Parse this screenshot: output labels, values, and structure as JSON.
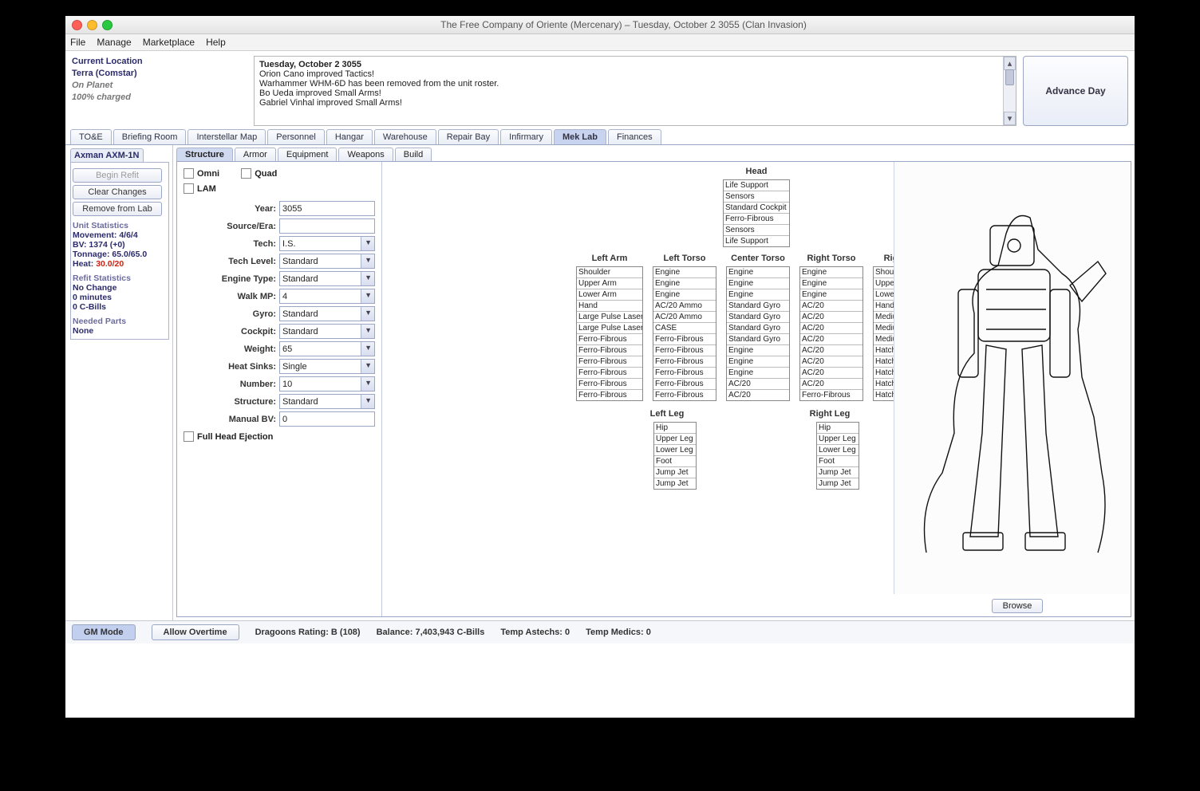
{
  "window": {
    "title": "The Free Company of Oriente (Mercenary) – Tuesday, October 2 3055 (Clan Invasion)"
  },
  "menu": {
    "file": "File",
    "manage": "Manage",
    "marketplace": "Marketplace",
    "help": "Help"
  },
  "location": {
    "label": "Current Location",
    "place": "Terra (Comstar)",
    "status": "On Planet",
    "charge": "100% charged"
  },
  "log": {
    "date": "Tuesday, October 2 3055",
    "lines": [
      "Orion Cano improved Tactics!",
      "Warhammer WHM-6D has been removed from the unit roster.",
      "Bo Ueda improved Small Arms!",
      "Gabriel Vinhal improved Small Arms!"
    ]
  },
  "advance": "Advance Day",
  "mainTabs": [
    "TO&E",
    "Briefing Room",
    "Interstellar Map",
    "Personnel",
    "Hangar",
    "Warehouse",
    "Repair Bay",
    "Infirmary",
    "Mek Lab",
    "Finances"
  ],
  "mainActive": "Mek Lab",
  "sidebar": {
    "unitTab": "Axman AXM-1N",
    "beginRefit": "Begin Refit",
    "clearChanges": "Clear Changes",
    "removeLab": "Remove from Lab",
    "unitStatsLabel": "Unit Statistics",
    "movement": "Movement: 4/6/4",
    "bv": "BV: 1374 (+0)",
    "tonnage": "Tonnage: 65.0/65.0",
    "heatLabel": "Heat:",
    "heatValue": "30.0/20",
    "refitLabel": "Refit Statistics",
    "noChange": "No Change",
    "minutes": "0 minutes",
    "cbills": "0 C-Bills",
    "neededLabel": "Needed Parts",
    "none": "None"
  },
  "subTabs": [
    "Structure",
    "Armor",
    "Equipment",
    "Weapons",
    "Build"
  ],
  "subActive": "Structure",
  "form": {
    "omni": "Omni",
    "quad": "Quad",
    "lam": "LAM",
    "fullHead": "Full Head Ejection",
    "yearL": "Year:",
    "year": "3055",
    "sourceL": "Source/Era:",
    "source": "",
    "techL": "Tech:",
    "tech": "I.S.",
    "techLevelL": "Tech Level:",
    "techLevel": "Standard",
    "engineL": "Engine Type:",
    "engine": "Standard",
    "walkL": "Walk MP:",
    "walk": "4",
    "gyroL": "Gyro:",
    "gyro": "Standard",
    "cockpitL": "Cockpit:",
    "cockpit": "Standard",
    "weightL": "Weight:",
    "weight": "65",
    "hsL": "Heat Sinks:",
    "hs": "Single",
    "numL": "Number:",
    "num": "10",
    "structL": "Structure:",
    "struct": "Standard",
    "mbvL": "Manual BV:",
    "mbv": "0"
  },
  "crits": {
    "head": {
      "title": "Head",
      "slots": [
        "Life Support",
        "Sensors",
        "Standard Cockpit",
        "Ferro-Fibrous",
        "Sensors",
        "Life Support"
      ]
    },
    "la": {
      "title": "Left Arm",
      "slots": [
        "Shoulder",
        "Upper Arm",
        "Lower Arm",
        "Hand",
        "Large Pulse Laser",
        "Large Pulse Laser",
        "Ferro-Fibrous",
        "Ferro-Fibrous",
        "Ferro-Fibrous",
        "Ferro-Fibrous",
        "Ferro-Fibrous",
        "Ferro-Fibrous"
      ]
    },
    "lt": {
      "title": "Left Torso",
      "slots": [
        "Engine",
        "Engine",
        "Engine",
        "AC/20 Ammo",
        "AC/20 Ammo",
        "CASE",
        "Ferro-Fibrous",
        "Ferro-Fibrous",
        "Ferro-Fibrous",
        "Ferro-Fibrous",
        "Ferro-Fibrous",
        "Ferro-Fibrous"
      ]
    },
    "ct": {
      "title": "Center Torso",
      "slots": [
        "Engine",
        "Engine",
        "Engine",
        "Standard Gyro",
        "Standard Gyro",
        "Standard Gyro",
        "Standard Gyro",
        "Engine",
        "Engine",
        "Engine",
        "AC/20",
        "AC/20"
      ]
    },
    "rt": {
      "title": "Right Torso",
      "slots": [
        "Engine",
        "Engine",
        "Engine",
        "AC/20",
        "AC/20",
        "AC/20",
        "AC/20",
        "AC/20",
        "AC/20",
        "AC/20",
        "AC/20",
        "Ferro-Fibrous"
      ]
    },
    "ra": {
      "title": "Right Arm",
      "slots": [
        "Shoulder",
        "Upper Arm",
        "Lower Arm",
        "Hand",
        "Medium Laser",
        "Medium Laser",
        "Medium Laser",
        "Hatchet",
        "Hatchet",
        "Hatchet",
        "Hatchet",
        "Hatchet"
      ]
    },
    "ll": {
      "title": "Left Leg",
      "slots": [
        "Hip",
        "Upper Leg",
        "Lower Leg",
        "Foot",
        "Jump Jet",
        "Jump Jet"
      ]
    },
    "rl": {
      "title": "Right Leg",
      "slots": [
        "Hip",
        "Upper Leg",
        "Lower Leg",
        "Foot",
        "Jump Jet",
        "Jump Jet"
      ]
    }
  },
  "browse": "Browse",
  "status": {
    "gm": "GM Mode",
    "overtime": "Allow Overtime",
    "dragoons": "Dragoons Rating: B (108)",
    "balance": "Balance: 7,403,943 C-Bills",
    "astechs": "Temp Astechs: 0",
    "medics": "Temp Medics: 0"
  }
}
